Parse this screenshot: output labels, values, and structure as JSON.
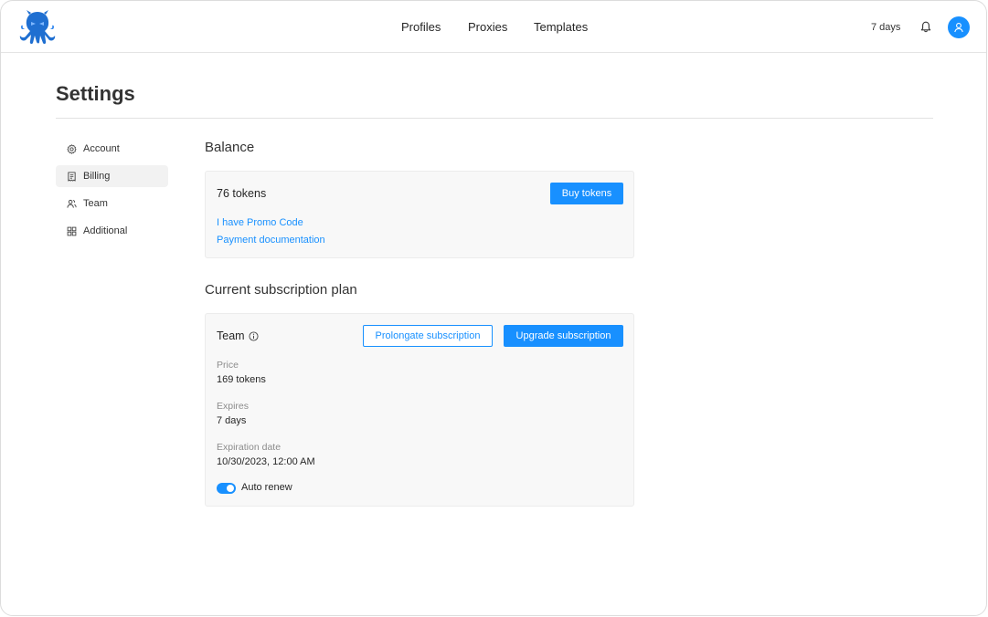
{
  "nav": {
    "profiles": "Profiles",
    "proxies": "Proxies",
    "templates": "Templates",
    "days_left": "7 days"
  },
  "page": {
    "title": "Settings"
  },
  "menu": {
    "items": [
      {
        "label": "Account",
        "icon": "gear-icon",
        "active": false
      },
      {
        "label": "Billing",
        "icon": "receipt-icon",
        "active": true
      },
      {
        "label": "Team",
        "icon": "team-icon",
        "active": false
      },
      {
        "label": "Additional",
        "icon": "apps-icon",
        "active": false
      }
    ]
  },
  "balance": {
    "title": "Balance",
    "tokens": "76 tokens",
    "buy_label": "Buy tokens",
    "promo_link": "I have Promo Code",
    "docs_link": "Payment documentation"
  },
  "plan": {
    "title": "Current subscription plan",
    "name": "Team",
    "prolong_label": "Prolongate subscription",
    "upgrade_label": "Upgrade subscription",
    "price_label": "Price",
    "price_value": "169 tokens",
    "expires_label": "Expires",
    "expires_value": "7 days",
    "expdate_label": "Expiration date",
    "expdate_value": "10/30/2023, 12:00 AM",
    "auto_renew_label": "Auto renew",
    "auto_renew_on": true
  },
  "colors": {
    "accent": "#1890ff",
    "card_bg": "#f8f8f8",
    "menu_active_bg": "#f2f2f2"
  }
}
